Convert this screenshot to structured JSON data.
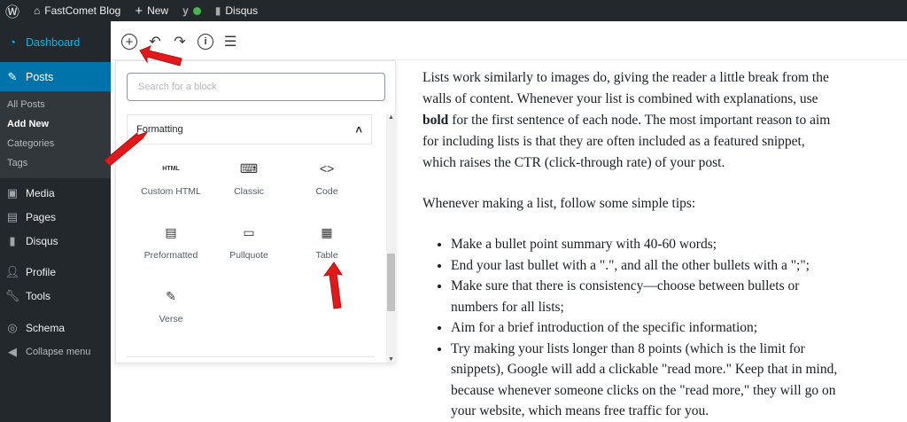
{
  "adminbar": {
    "site": "FastComet Blog",
    "new": "New",
    "disqus": "Disqus",
    "status_color": "#46b450"
  },
  "sidebar": {
    "items": [
      {
        "label": "Dashboard",
        "icon": "dashboard-icon"
      },
      {
        "label": "Posts",
        "icon": "pin-icon",
        "active": true
      },
      {
        "label": "Media",
        "icon": "media-icon"
      },
      {
        "label": "Pages",
        "icon": "pages-icon"
      },
      {
        "label": "Disqus",
        "icon": "comment-icon"
      },
      {
        "label": "Profile",
        "icon": "user-icon"
      },
      {
        "label": "Tools",
        "icon": "wrench-icon"
      },
      {
        "label": "Schema",
        "icon": "schema-icon"
      },
      {
        "label": "Collapse menu",
        "icon": "collapse-icon"
      }
    ],
    "submenu": [
      "All Posts",
      "Add New",
      "Categories",
      "Tags"
    ],
    "accent": "#0073aa"
  },
  "inserter": {
    "search_placeholder": "Search for a block",
    "section": "Formatting",
    "blocks": [
      {
        "label": "Custom HTML",
        "icon": "html-icon",
        "glyph": "HTML"
      },
      {
        "label": "Classic",
        "icon": "keyboard-icon",
        "glyph": "⌨"
      },
      {
        "label": "Code",
        "icon": "code-icon",
        "glyph": "<>"
      },
      {
        "label": "Preformatted",
        "icon": "preformatted-icon",
        "glyph": "▤"
      },
      {
        "label": "Pullquote",
        "icon": "pullquote-icon",
        "glyph": "▭"
      },
      {
        "label": "Table",
        "icon": "table-icon",
        "glyph": "▦"
      },
      {
        "label": "Verse",
        "icon": "pencil-icon",
        "glyph": "✎"
      }
    ]
  },
  "content": {
    "p1a": "Lists work similarly to images do, giving the reader a little break from the walls of content. Whenever your list is combined with explanations, use ",
    "p1bold": "bold",
    "p1b": " for the first sentence of each node. The most important reason to aim for including lists is that they are often included as a featured snippet, which raises the CTR (click-through rate) of your post.",
    "p2": "Whenever making a list, follow some simple tips:",
    "bullets": [
      "Make a bullet point summary with 40-60 words;",
      "End your last bullet with a \".\", and all the other bullets with a \";\";",
      "Make sure that there is consistency—choose between bullets or numbers for all lists;",
      "Aim for a brief introduction of the specific information;",
      "Try making your lists longer than 8 points (which is the limit for snippets), Google will add a clickable \"read more.\" Keep that in mind, because whenever someone clicks on the \"read more,\" they will go on your website, which means free traffic for you."
    ]
  }
}
